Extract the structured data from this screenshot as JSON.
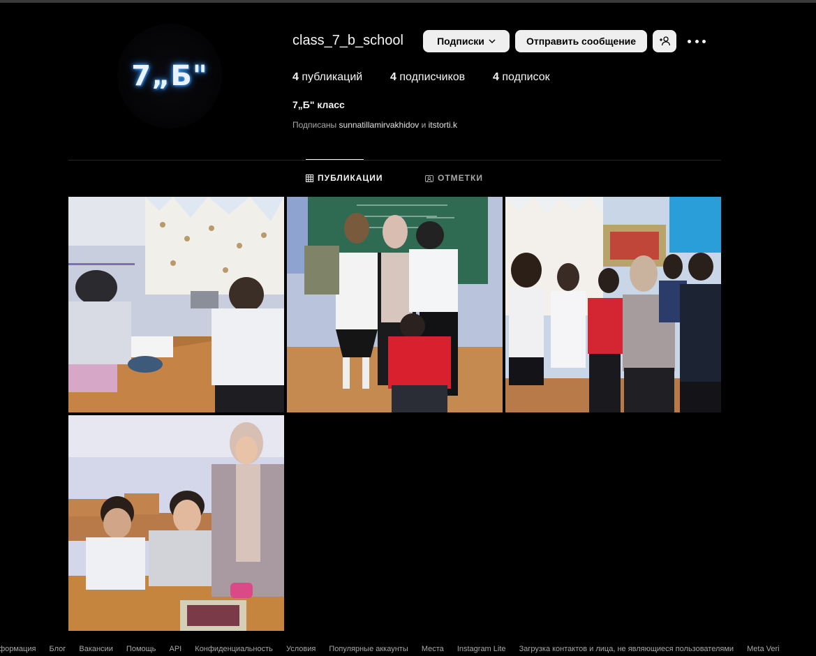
{
  "profile": {
    "avatar_text": "7„Б\"",
    "username": "class_7_b_school",
    "full_name": "7„Б\" класс",
    "followed_by_prefix": "Подписаны",
    "followed_by_1": "sunnatillamirvakhidov",
    "followed_by_and": "и",
    "followed_by_2": "itstorti.k"
  },
  "actions": {
    "following_label": "Подписки",
    "message_label": "Отправить сообщение",
    "add_user_icon": "add-user-icon",
    "more_icon": "more-options-icon"
  },
  "stats": {
    "posts_count": "4",
    "posts_label": "публикаций",
    "followers_count": "4",
    "followers_label": "подписчиков",
    "following_count": "4",
    "following_label": "подписок"
  },
  "tabs": [
    {
      "label": "ПУБЛИКАЦИИ",
      "icon": "grid-icon",
      "active": true
    },
    {
      "label": "ОТМЕТКИ",
      "icon": "tagged-icon",
      "active": false
    }
  ],
  "posts": [
    {
      "name": "post-1"
    },
    {
      "name": "post-2"
    },
    {
      "name": "post-3"
    },
    {
      "name": "post-4"
    }
  ],
  "footer": [
    "нформация",
    "Блог",
    "Вакансии",
    "Помощь",
    "API",
    "Конфиденциальность",
    "Условия",
    "Популярные аккаунты",
    "Места",
    "Instagram Lite",
    "Загрузка контактов и лица, не являющиеся пользователями",
    "Meta Veri"
  ],
  "colors": {
    "background": "#000000",
    "button_bg": "#efefef",
    "muted_text": "#a8a8a8"
  }
}
